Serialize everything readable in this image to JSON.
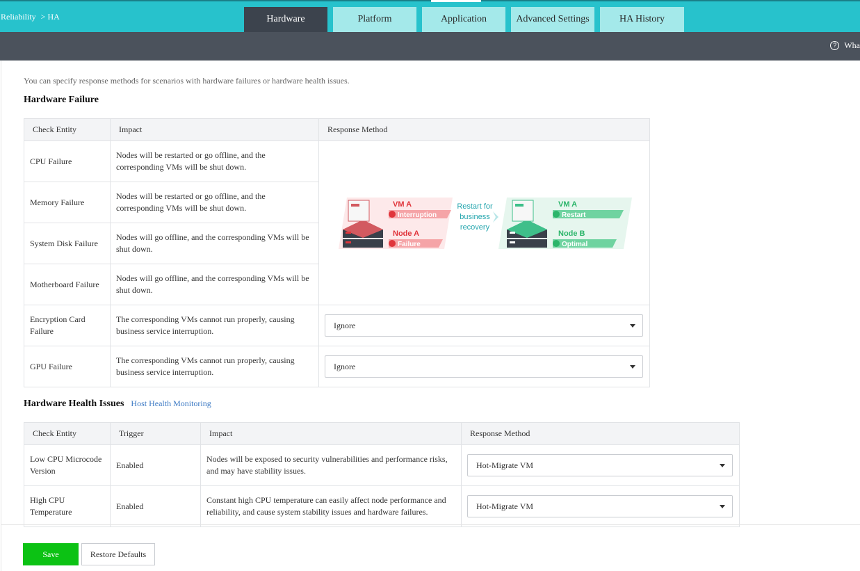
{
  "breadcrumb": {
    "parent": "Reliability",
    "separator": ">",
    "current": "HA"
  },
  "tabs": [
    {
      "label": "Hardware"
    },
    {
      "label": "Platform"
    },
    {
      "label": "Application"
    },
    {
      "label": "Advanced Settings"
    },
    {
      "label": "HA History"
    }
  ],
  "help": {
    "label": "Wha"
  },
  "intro": "You can specify response methods for scenarios with hardware failures or hardware health issues.",
  "hardware_failure": {
    "title": "Hardware Failure",
    "headers": [
      "Check Entity",
      "Impact",
      "Response Method"
    ],
    "rows": [
      {
        "entity": "CPU Failure",
        "impact": "Nodes will be restarted or go offline, and the corresponding VMs will be shut down."
      },
      {
        "entity": "Memory Failure",
        "impact": "Nodes will be restarted or go offline, and the corresponding VMs will be shut down."
      },
      {
        "entity": "System Disk Failure",
        "impact": "Nodes will go offline, and the corresponding VMs will be shut down."
      },
      {
        "entity": "Motherboard Failure",
        "impact": "Nodes will go offline, and the corresponding VMs will be shut down."
      },
      {
        "entity": "Encryption Card Failure",
        "impact": "The corresponding VMs cannot run properly, causing business service interruption.",
        "response": "Ignore"
      },
      {
        "entity": "GPU Failure",
        "impact": "The corresponding VMs cannot run properly, causing business service interruption.",
        "response": "Ignore"
      }
    ],
    "diagram": {
      "vm_a_left": "VM A",
      "interruption": "Interruption",
      "node_a": "Node A",
      "failure": "Failure",
      "restart_line1": "Restart for",
      "restart_line2": "business",
      "restart_line3": "recovery",
      "vm_a_right": "VM A",
      "restart": "Restart",
      "node_b": "Node B",
      "optimal": "Optimal"
    }
  },
  "health_issues": {
    "title": "Hardware Health Issues",
    "link": "Host Health Monitoring",
    "headers": [
      "Check Entity",
      "Trigger",
      "Impact",
      "Response Method"
    ],
    "rows": [
      {
        "entity": "Low CPU Microcode Version",
        "trigger": "Enabled",
        "impact": "Nodes will be exposed to security vulnerabilities and performance risks, and may have stability issues.",
        "response": "Hot-Migrate VM"
      },
      {
        "entity": "High CPU Temperature",
        "trigger": "Enabled",
        "impact": "Constant high CPU temperature can easily affect node performance and reliability, and cause system stability issues and hardware failures.",
        "response": "Hot-Migrate VM"
      }
    ]
  },
  "footer": {
    "save": "Save",
    "restore": "Restore Defaults"
  },
  "colors": {
    "topbar": "#27c2cc",
    "tab_active": "#3c434d",
    "tab_inactive": "#a4e9ea",
    "subbar": "#4b525c",
    "save": "#0cc214",
    "failure": "#e0353b",
    "optimal": "#2cb56a"
  }
}
